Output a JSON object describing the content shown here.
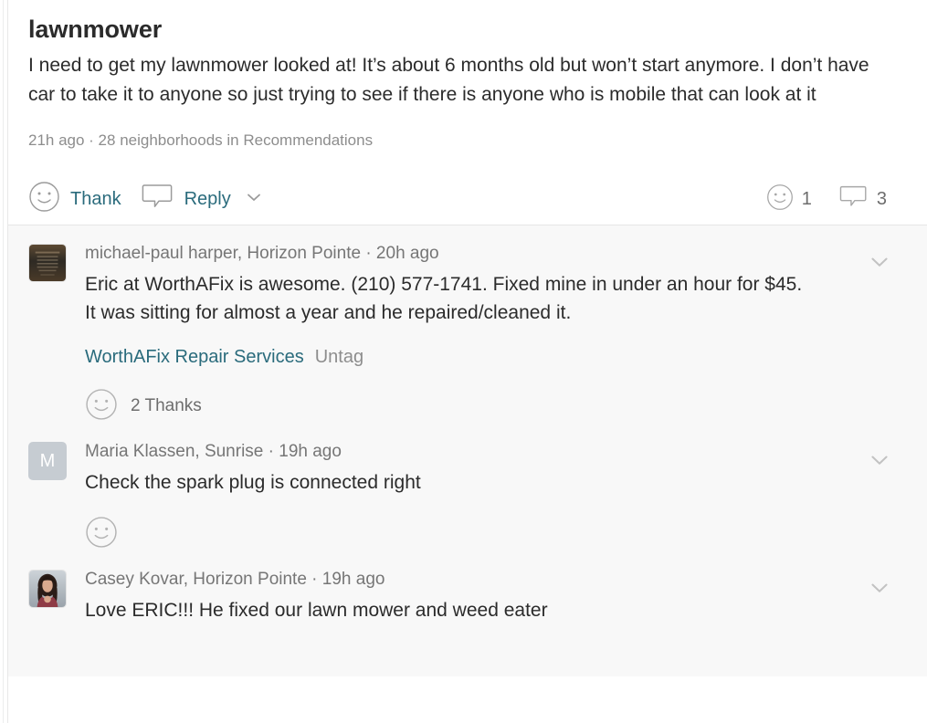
{
  "post": {
    "title": "lawnmower",
    "body": "I need to get my lawnmower looked at! It’s about 6 months old but won’t start anymore. I don’t have car to take it to anyone so just trying to see if there is anyone who is mobile that can look at it",
    "meta": "21h ago · 28 neighborhoods in Recommendations",
    "actions": {
      "thank_label": "Thank",
      "reply_label": "Reply",
      "thank_icon": "smiley-icon",
      "reply_icon": "speech-bubble-icon",
      "more_icon": "chevron-down-icon"
    },
    "counts": {
      "reactions": "1",
      "reaction_icon": "smiley-icon",
      "comments": "3",
      "comment_icon": "speech-bubble-icon"
    }
  },
  "colors": {
    "link": "#2a6b7c",
    "text": "#2b2b2b",
    "muted": "#8d8d8d",
    "header_muted": "#767676",
    "comment_bg": "#f8f8f8",
    "post_bg": "#ffffff",
    "divider": "#e6e6e6",
    "avatar_initial_bg": "#c6ccd2"
  },
  "comments": [
    {
      "header": "michael-paul harper, Horizon Pointe · 20h ago",
      "text": "Eric at WorthAFix is awesome. (210) 577-1741. Fixed mine in under an hour for $45. It was sitting for almost a year and he repaired/cleaned it.",
      "avatar_type": "photo-dark",
      "avatar_initial": "",
      "tag_link": "WorthAFix Repair Services",
      "untag_label": "Untag",
      "thanks_label": "2 Thanks",
      "thanks_icon": "smiley-icon",
      "chevron_icon": "chevron-down-icon"
    },
    {
      "header": "Maria Klassen, Sunrise · 19h ago",
      "text": "Check the spark plug is connected right",
      "avatar_type": "initial",
      "avatar_initial": "M",
      "tag_link": "",
      "untag_label": "",
      "thanks_label": "",
      "thanks_icon": "smiley-icon",
      "chevron_icon": "chevron-down-icon"
    },
    {
      "header": "Casey Kovar, Horizon Pointe · 19h ago",
      "text": "Love ERIC!!! He fixed our lawn mower and weed eater",
      "avatar_type": "photo-portrait",
      "avatar_initial": "",
      "tag_link": "",
      "untag_label": "",
      "thanks_label": "",
      "thanks_icon": "smiley-icon",
      "chevron_icon": "chevron-down-icon"
    }
  ]
}
